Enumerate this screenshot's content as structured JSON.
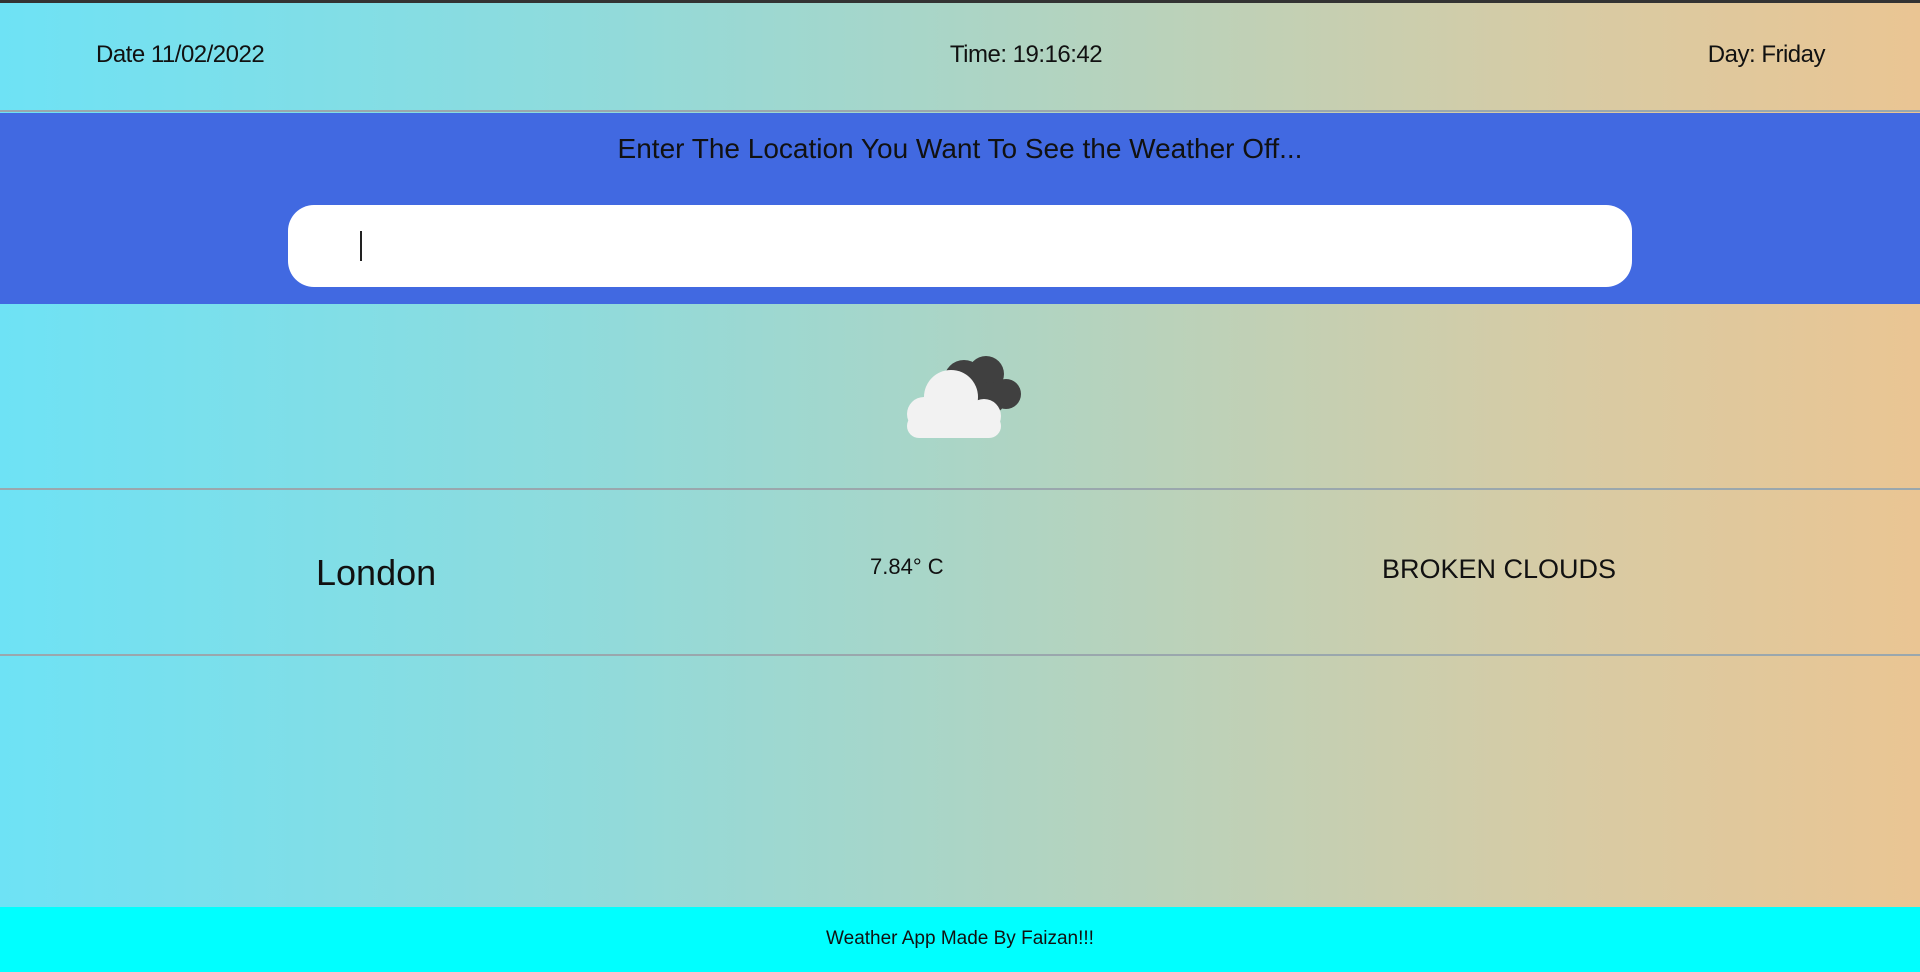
{
  "header": {
    "date_text": "Date 11/02/2022",
    "time_text": "Time: 19:16:42",
    "day_text": "Day: Friday"
  },
  "search": {
    "prompt": "Enter The Location You Want To See the Weather Off...",
    "value": "",
    "placeholder": ""
  },
  "weather": {
    "icon": "broken-clouds-icon",
    "city": "London",
    "temperature": "7.84° C",
    "condition": "BROKEN CLOUDS"
  },
  "footer": {
    "text": "Weather App Made By Faizan!!!"
  },
  "colors": {
    "search_band": "#4169e1",
    "footer": "#00ffff",
    "gradient_start": "#6ee2f5",
    "gradient_end": "#eac593"
  }
}
